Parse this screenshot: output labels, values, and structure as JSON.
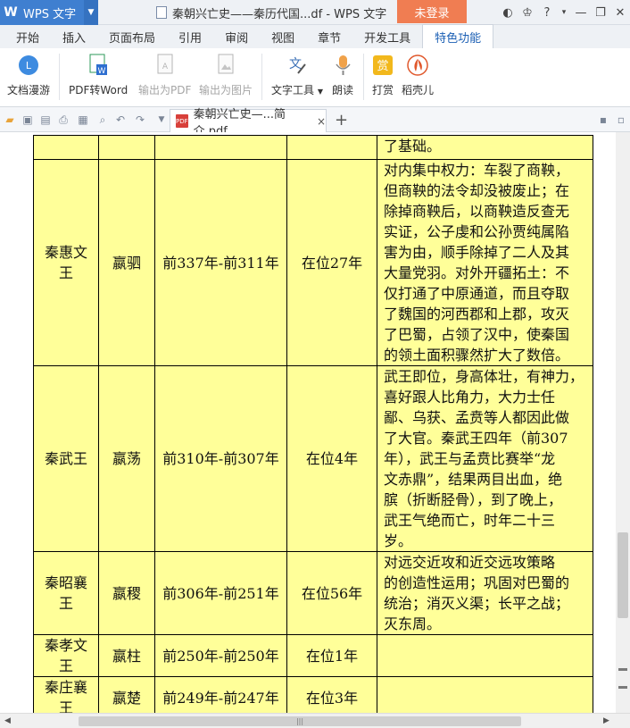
{
  "app": {
    "name": "WPS 文字",
    "window_title": "秦朝兴亡史——秦历代国...df - WPS 文字",
    "login_label": "未登录"
  },
  "tabs": [
    {
      "label": "开始"
    },
    {
      "label": "插入"
    },
    {
      "label": "页面布局"
    },
    {
      "label": "引用"
    },
    {
      "label": "审阅"
    },
    {
      "label": "视图"
    },
    {
      "label": "章节"
    },
    {
      "label": "开发工具"
    },
    {
      "label": "特色功能"
    }
  ],
  "ribbon": {
    "doc_roam": "文档漫游",
    "pdf_to_word": "PDF转Word",
    "export_pdf": "输出为PDF",
    "export_image": "输出为图片",
    "text_tools": "文字工具",
    "read_aloud": "朗读",
    "reward": "打赏",
    "docer": "稻壳儿"
  },
  "doc_tab": {
    "title": "秦朝兴亡史—...简介.pdf",
    "close": "×"
  },
  "colors": {
    "table_bg": "#ffff99",
    "accent": "#3f7fd0",
    "login": "#f07d52"
  },
  "table": {
    "rows": [
      {
        "name": "",
        "given": "",
        "years": "",
        "reign": "",
        "notes": [
          "了基础。"
        ]
      },
      {
        "name": "秦惠文王",
        "given": "嬴驷",
        "years": "前337年-前311年",
        "reign": "在位27年",
        "notes": [
          "对内集中权力：车裂了商鞅，",
          "但商鞅的法令却没被废止；在",
          "除掉商鞅后，以商鞅造反查无",
          "实证，公子虔和公孙贾纯属陷",
          "害为由，顺手除掉了二人及其",
          "大量党羽。对外开疆拓土：不",
          "仅打通了中原通道，而且夺取",
          "了魏国的河西郡和上郡，攻灭",
          "了巴蜀，占领了汉中，使秦国",
          "的领土面积骤然扩大了数倍。"
        ]
      },
      {
        "name": "秦武王",
        "given": "嬴荡",
        "years": "前310年-前307年",
        "reign": "在位4年",
        "notes": [
          "武王即位，身高体壮，有神力，",
          "喜好跟人比角力，大力士任",
          "鄙、乌获、孟贲等人都因此做",
          "了大官。秦武王四年（前307",
          "年），武王与孟贲比赛举“龙",
          "文赤鼎”，结果两目出血，绝",
          "膑（折断胫骨），到了晚上，",
          "武王气绝而亡，时年二十三",
          "岁。"
        ]
      },
      {
        "name": "秦昭襄王",
        "given": "嬴稷",
        "years": "前306年-前251年",
        "reign": "在位56年",
        "notes": [
          "对远交近攻和近交远攻策略",
          "的创造性运用；巩固对巴蜀的",
          "统治；消灭义渠；长平之战；",
          "灭东周。"
        ]
      },
      {
        "name": "秦孝文王",
        "given": "嬴柱",
        "years": "前250年-前250年",
        "reign": "在位1年",
        "notes": []
      },
      {
        "name": "秦庄襄王",
        "given": "嬴楚",
        "years": "前249年-前247年",
        "reign": "在位3年",
        "notes": []
      }
    ]
  }
}
